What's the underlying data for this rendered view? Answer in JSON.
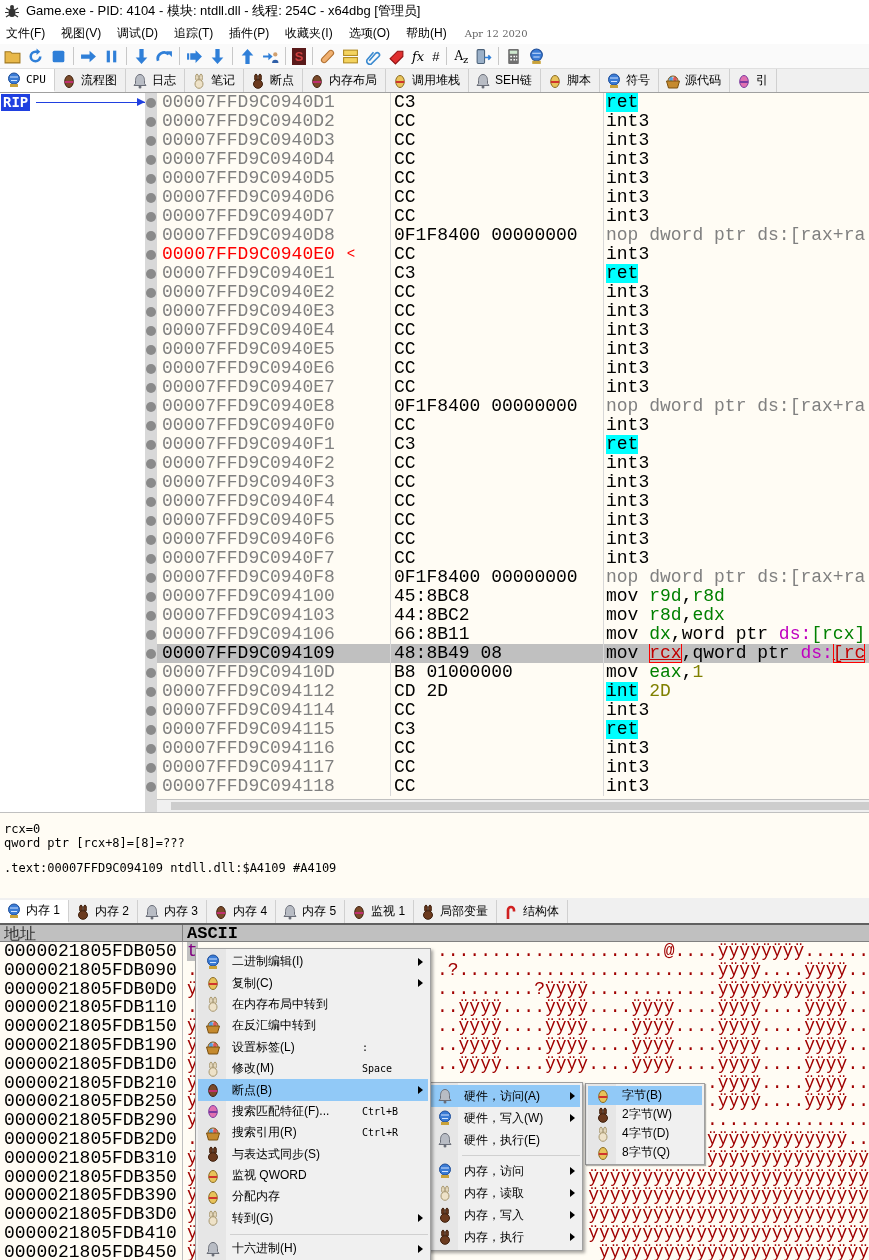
{
  "window": {
    "title": "Game.exe - PID: 4104 - 模块: ntdll.dll - 线程: 254C - x64dbg [管理员]"
  },
  "menu_bar": {
    "items": [
      "文件(F)",
      "视图(V)",
      "调试(D)",
      "追踪(T)",
      "插件(P)",
      "收藏夹(I)",
      "选项(O)",
      "帮助(H)"
    ],
    "build_date": "Apr 12 2020"
  },
  "toolbar": {
    "glyphs": [
      "S",
      "fx",
      "#",
      "A$_{z}$"
    ]
  },
  "tabs": [
    {
      "label": "CPU",
      "selected": true
    },
    {
      "label": "流程图",
      "selected": false
    },
    {
      "label": "日志",
      "selected": false
    },
    {
      "label": "笔记",
      "selected": false
    },
    {
      "label": "断点",
      "selected": false
    },
    {
      "label": "内存布局",
      "selected": false
    },
    {
      "label": "调用堆栈",
      "selected": false
    },
    {
      "label": "SEH链",
      "selected": false
    },
    {
      "label": "脚本",
      "selected": false
    },
    {
      "label": "符号",
      "selected": false
    },
    {
      "label": "源代码",
      "selected": false
    },
    {
      "label": "引",
      "selected": false
    }
  ],
  "disassembly": {
    "rip_label": "RIP",
    "rows": [
      {
        "address": "00007FFD9C0940D1",
        "bytes": "C3",
        "mnemonic": "ret",
        "kind": "ret",
        "rip": true,
        "target": false,
        "selected": false
      },
      {
        "address": "00007FFD9C0940D2",
        "bytes": "CC",
        "mnemonic": "int3",
        "kind": "plain",
        "rip": false,
        "target": false,
        "selected": false
      },
      {
        "address": "00007FFD9C0940D3",
        "bytes": "CC",
        "mnemonic": "int3",
        "kind": "plain",
        "rip": false,
        "target": false,
        "selected": false
      },
      {
        "address": "00007FFD9C0940D4",
        "bytes": "CC",
        "mnemonic": "int3",
        "kind": "plain",
        "rip": false,
        "target": false,
        "selected": false
      },
      {
        "address": "00007FFD9C0940D5",
        "bytes": "CC",
        "mnemonic": "int3",
        "kind": "plain",
        "rip": false,
        "target": false,
        "selected": false
      },
      {
        "address": "00007FFD9C0940D6",
        "bytes": "CC",
        "mnemonic": "int3",
        "kind": "plain",
        "rip": false,
        "target": false,
        "selected": false
      },
      {
        "address": "00007FFD9C0940D7",
        "bytes": "CC",
        "mnemonic": "int3",
        "kind": "plain",
        "rip": false,
        "target": false,
        "selected": false
      },
      {
        "address": "00007FFD9C0940D8",
        "bytes": "0F1F8400 00000000",
        "mnemonic": "nop",
        "kind": "nop",
        "operands": [
          {
            "text": "dword ptr ds:[rax+ra",
            "kind": "txt"
          }
        ],
        "rip": false,
        "target": false,
        "selected": false
      },
      {
        "address": "00007FFD9C0940E0",
        "bytes": "CC",
        "mnemonic": "int3",
        "kind": "plain",
        "rip": false,
        "target": true,
        "arrow": "<",
        "selected": false
      },
      {
        "address": "00007FFD9C0940E1",
        "bytes": "C3",
        "mnemonic": "ret",
        "kind": "ret",
        "rip": false,
        "target": false,
        "selected": false
      },
      {
        "address": "00007FFD9C0940E2",
        "bytes": "CC",
        "mnemonic": "int3",
        "kind": "plain",
        "rip": false,
        "target": false,
        "selected": false
      },
      {
        "address": "00007FFD9C0940E3",
        "bytes": "CC",
        "mnemonic": "int3",
        "kind": "plain",
        "rip": false,
        "target": false,
        "selected": false
      },
      {
        "address": "00007FFD9C0940E4",
        "bytes": "CC",
        "mnemonic": "int3",
        "kind": "plain",
        "rip": false,
        "target": false,
        "selected": false
      },
      {
        "address": "00007FFD9C0940E5",
        "bytes": "CC",
        "mnemonic": "int3",
        "kind": "plain",
        "rip": false,
        "target": false,
        "selected": false
      },
      {
        "address": "00007FFD9C0940E6",
        "bytes": "CC",
        "mnemonic": "int3",
        "kind": "plain",
        "rip": false,
        "target": false,
        "selected": false
      },
      {
        "address": "00007FFD9C0940E7",
        "bytes": "CC",
        "mnemonic": "int3",
        "kind": "plain",
        "rip": false,
        "target": false,
        "selected": false
      },
      {
        "address": "00007FFD9C0940E8",
        "bytes": "0F1F8400 00000000",
        "mnemonic": "nop",
        "kind": "nop",
        "operands": [
          {
            "text": "dword ptr ds:[rax+ra",
            "kind": "txt"
          }
        ],
        "rip": false,
        "target": false,
        "selected": false
      },
      {
        "address": "00007FFD9C0940F0",
        "bytes": "CC",
        "mnemonic": "int3",
        "kind": "plain",
        "rip": false,
        "target": false,
        "selected": false
      },
      {
        "address": "00007FFD9C0940F1",
        "bytes": "C3",
        "mnemonic": "ret",
        "kind": "ret",
        "rip": false,
        "target": false,
        "selected": false
      },
      {
        "address": "00007FFD9C0940F2",
        "bytes": "CC",
        "mnemonic": "int3",
        "kind": "plain",
        "rip": false,
        "target": false,
        "selected": false
      },
      {
        "address": "00007FFD9C0940F3",
        "bytes": "CC",
        "mnemonic": "int3",
        "kind": "plain",
        "rip": false,
        "target": false,
        "selected": false
      },
      {
        "address": "00007FFD9C0940F4",
        "bytes": "CC",
        "mnemonic": "int3",
        "kind": "plain",
        "rip": false,
        "target": false,
        "selected": false
      },
      {
        "address": "00007FFD9C0940F5",
        "bytes": "CC",
        "mnemonic": "int3",
        "kind": "plain",
        "rip": false,
        "target": false,
        "selected": false
      },
      {
        "address": "00007FFD9C0940F6",
        "bytes": "CC",
        "mnemonic": "int3",
        "kind": "plain",
        "rip": false,
        "target": false,
        "selected": false
      },
      {
        "address": "00007FFD9C0940F7",
        "bytes": "CC",
        "mnemonic": "int3",
        "kind": "plain",
        "rip": false,
        "target": false,
        "selected": false
      },
      {
        "address": "00007FFD9C0940F8",
        "bytes": "0F1F8400 00000000",
        "mnemonic": "nop",
        "kind": "nop",
        "operands": [
          {
            "text": "dword ptr ds:[rax+ra",
            "kind": "txt"
          }
        ],
        "rip": false,
        "target": false,
        "selected": false
      },
      {
        "address": "00007FFD9C094100",
        "bytes": "45:8BC8",
        "mnemonic": "mov",
        "kind": "plain",
        "operands": [
          {
            "text": "r9d",
            "kind": "reg"
          },
          {
            "text": ",",
            "kind": "txt"
          },
          {
            "text": "r8d",
            "kind": "reg"
          }
        ],
        "rip": false,
        "target": false,
        "selected": false
      },
      {
        "address": "00007FFD9C094103",
        "bytes": "44:8BC2",
        "mnemonic": "mov",
        "kind": "plain",
        "operands": [
          {
            "text": "r8d",
            "kind": "reg"
          },
          {
            "text": ",",
            "kind": "txt"
          },
          {
            "text": "edx",
            "kind": "reg"
          }
        ],
        "rip": false,
        "target": false,
        "selected": false
      },
      {
        "address": "00007FFD9C094106",
        "bytes": "66:8B11",
        "mnemonic": "mov",
        "kind": "plain",
        "operands": [
          {
            "text": "dx",
            "kind": "reg"
          },
          {
            "text": ",word ptr ",
            "kind": "txt"
          },
          {
            "text": "ds:",
            "kind": "seg"
          },
          {
            "text": "[rcx]",
            "kind": "reg"
          }
        ],
        "rip": false,
        "target": false,
        "selected": false
      },
      {
        "address": "00007FFD9C094109",
        "bytes": "48:8B49 08",
        "mnemonic": "mov",
        "kind": "plain",
        "operands": [
          {
            "text": "rcx",
            "kind": "hot"
          },
          {
            "text": ",qword ptr ",
            "kind": "txt"
          },
          {
            "text": "ds:",
            "kind": "seg"
          },
          {
            "text": "[rc",
            "kind": "hot"
          }
        ],
        "rip": false,
        "target": false,
        "selected": true
      },
      {
        "address": "00007FFD9C09410D",
        "bytes": "B8 01000000",
        "mnemonic": "mov",
        "kind": "plain",
        "operands": [
          {
            "text": "eax",
            "kind": "reg"
          },
          {
            "text": ",",
            "kind": "txt"
          },
          {
            "text": "1",
            "kind": "num"
          }
        ],
        "rip": false,
        "target": false,
        "selected": false
      },
      {
        "address": "00007FFD9C094112",
        "bytes": "CD 2D",
        "mnemonic": "int",
        "kind": "ret",
        "operands": [
          {
            "text": "2D",
            "kind": "num"
          }
        ],
        "rip": false,
        "target": false,
        "selected": false
      },
      {
        "address": "00007FFD9C094114",
        "bytes": "CC",
        "mnemonic": "int3",
        "kind": "plain",
        "rip": false,
        "target": false,
        "selected": false
      },
      {
        "address": "00007FFD9C094115",
        "bytes": "C3",
        "mnemonic": "ret",
        "kind": "ret",
        "rip": false,
        "target": false,
        "selected": false
      },
      {
        "address": "00007FFD9C094116",
        "bytes": "CC",
        "mnemonic": "int3",
        "kind": "plain",
        "rip": false,
        "target": false,
        "selected": false
      },
      {
        "address": "00007FFD9C094117",
        "bytes": "CC",
        "mnemonic": "int3",
        "kind": "plain",
        "rip": false,
        "target": false,
        "selected": false
      },
      {
        "address": "00007FFD9C094118",
        "bytes": "CC",
        "mnemonic": "int3",
        "kind": "plain",
        "rip": false,
        "target": false,
        "selected": false
      }
    ]
  },
  "info_pane": {
    "lines": [
      "rcx=0",
      "qword ptr [rcx+8]=[8]=???"
    ],
    "location": ".text:00007FFD9C094109 ntdll.dll:$A4109 #A4109"
  },
  "bottom_tabs": [
    {
      "label": "内存 1",
      "selected": true
    },
    {
      "label": "内存 2",
      "selected": false
    },
    {
      "label": "内存 3",
      "selected": false
    },
    {
      "label": "内存 4",
      "selected": false
    },
    {
      "label": "内存 5",
      "selected": false
    },
    {
      "label": "监视 1",
      "selected": false
    },
    {
      "label": "局部变量",
      "selected": false
    },
    {
      "label": "结构体",
      "selected": false
    }
  ],
  "memory_dump": {
    "columns": [
      "地址",
      "ASCII"
    ],
    "rows": [
      {
        "address": "0000021805FDB050",
        "lead": "t",
        "selected": true,
        "tail": ".....................@....ÿÿÿÿÿÿÿÿ......"
      },
      {
        "address": "0000021805FDB090",
        "lead": ".",
        "selected": false,
        "tail": ".?........................ÿÿÿÿ....ÿÿÿÿ.."
      },
      {
        "address": "0000021805FDB0D0",
        "lead": "ÿ",
        "selected": false,
        "tail": ".........?ÿÿÿÿ............ÿÿÿÿÿÿÿÿÿÿÿÿ.."
      },
      {
        "address": "0000021805FDB110",
        "lead": ".",
        "selected": false,
        "tail": "..ÿÿÿÿ....ÿÿÿÿ....ÿÿÿÿ....ÿÿÿÿ....ÿÿÿÿ.."
      },
      {
        "address": "0000021805FDB150",
        "lead": "ÿ",
        "selected": false,
        "tail": "..ÿÿÿÿ....ÿÿÿÿ....ÿÿÿÿ....ÿÿÿÿ....ÿÿÿÿ.."
      },
      {
        "address": "0000021805FDB190",
        "lead": "ÿ",
        "selected": false,
        "tail": "..ÿÿÿÿ....ÿÿÿÿ....ÿÿÿÿ....ÿÿÿÿ....ÿÿÿÿ.."
      },
      {
        "address": "0000021805FDB1D0",
        "lead": "ÿ",
        "selected": false,
        "tail": "..ÿÿÿÿ....ÿÿÿÿ....ÿÿÿÿ....ÿÿÿÿ....ÿÿÿÿ.."
      },
      {
        "address": "0000021805FDB210",
        "lead": "ÿ",
        "selected": false,
        "tail": ".ÿÿÿÿ....ÿÿÿÿ.."
      },
      {
        "address": "0000021805FDB250",
        "lead": "ÿ",
        "selected": false,
        "tail": ".ÿÿÿÿ....ÿÿÿÿ.."
      },
      {
        "address": "0000021805FDB290",
        "lead": "ÿ",
        "selected": false,
        "tail": "..............."
      },
      {
        "address": "0000021805FDB2D0",
        "lead": ".",
        "selected": false,
        "tail": "ÿÿÿÿÿÿÿÿÿÿÿÿÿ.."
      },
      {
        "address": "0000021805FDB310",
        "lead": "ÿ",
        "selected": false,
        "tail": "ÿÿÿÿÿÿÿÿÿÿÿÿÿÿÿ"
      },
      {
        "address": "0000021805FDB350",
        "lead": "ÿ",
        "selected": false,
        "tail": "ÿÿÿÿÿÿÿÿÿÿÿÿÿÿÿÿÿÿÿÿÿÿÿÿÿÿ"
      },
      {
        "address": "0000021805FDB390",
        "lead": "ÿ",
        "selected": false,
        "tail": "ÿÿÿÿÿÿÿÿÿÿÿÿÿÿÿÿÿÿÿÿÿÿÿÿÿÿ"
      },
      {
        "address": "0000021805FDB3D0",
        "lead": "ÿ",
        "selected": false,
        "tail": "ÿÿÿÿÿÿÿÿÿÿÿÿÿÿÿÿÿÿÿÿÿÿÿÿÿÿ"
      },
      {
        "address": "0000021805FDB410",
        "lead": "ÿ",
        "selected": false,
        "tail": "ÿÿÿÿÿÿÿÿÿÿÿÿÿÿÿÿÿÿÿÿÿÿÿÿÿÿ"
      },
      {
        "address": "0000021805FDB450",
        "lead": "ÿ",
        "selected": false,
        "tail": "ÿÿÿÿÿÿÿÿÿÿÿÿÿÿÿÿÿÿÿÿÿÿÿÿÿ"
      }
    ]
  },
  "context_menu": {
    "items": [
      {
        "kind": "item",
        "label": "二进制编辑(I)",
        "arrow": true,
        "selected": false
      },
      {
        "kind": "item",
        "label": "复制(C)",
        "arrow": true,
        "selected": false
      },
      {
        "kind": "item",
        "label": "在内存布局中转到",
        "arrow": false,
        "selected": false
      },
      {
        "kind": "item",
        "label": "在反汇编中转到",
        "arrow": false,
        "selected": false
      },
      {
        "kind": "item",
        "label": "设置标签(L)",
        "shortcut": ":",
        "arrow": false,
        "selected": false
      },
      {
        "kind": "item",
        "label": "修改(M)",
        "shortcut": "Space",
        "arrow": false,
        "selected": false
      },
      {
        "kind": "item",
        "label": "断点(B)",
        "arrow": true,
        "selected": true,
        "submenu": {
          "items": [
            {
              "kind": "item",
              "label": "硬件，访问(A)",
              "arrow": true,
              "selected": true,
              "submenu": {
                "items": [
                  {
                    "kind": "item",
                    "label": "字节(B)",
                    "arrow": false,
                    "selected": true
                  },
                  {
                    "kind": "item",
                    "label": "2字节(W)",
                    "arrow": false,
                    "selected": false
                  },
                  {
                    "kind": "item",
                    "label": "4字节(D)",
                    "arrow": false,
                    "selected": false
                  },
                  {
                    "kind": "item",
                    "label": "8字节(Q)",
                    "arrow": false,
                    "selected": false
                  }
                ]
              }
            },
            {
              "kind": "item",
              "label": "硬件，写入(W)",
              "arrow": true,
              "selected": false
            },
            {
              "kind": "item",
              "label": "硬件，执行(E)",
              "arrow": false,
              "selected": false
            },
            {
              "kind": "separator"
            },
            {
              "kind": "item",
              "label": "内存，访问",
              "arrow": true,
              "selected": false
            },
            {
              "kind": "item",
              "label": "内存，读取",
              "arrow": true,
              "selected": false
            },
            {
              "kind": "item",
              "label": "内存，写入",
              "arrow": true,
              "selected": false
            },
            {
              "kind": "item",
              "label": "内存，执行",
              "arrow": true,
              "selected": false
            }
          ]
        }
      },
      {
        "kind": "item",
        "label": "搜索匹配特征(F)...",
        "shortcut": "Ctrl+B",
        "arrow": false,
        "selected": false
      },
      {
        "kind": "item",
        "label": "搜索引用(R)",
        "shortcut": "Ctrl+R",
        "arrow": false,
        "selected": false
      },
      {
        "kind": "item",
        "label": "与表达式同步(S)",
        "arrow": false,
        "selected": false
      },
      {
        "kind": "item",
        "label": "监视 QWORD",
        "arrow": false,
        "selected": false
      },
      {
        "kind": "item",
        "label": "分配内存",
        "arrow": false,
        "selected": false
      },
      {
        "kind": "item",
        "label": "转到(G)",
        "arrow": true,
        "selected": false
      },
      {
        "kind": "separator"
      },
      {
        "kind": "item",
        "label": "十六进制(H)",
        "arrow": true,
        "selected": false
      }
    ]
  }
}
